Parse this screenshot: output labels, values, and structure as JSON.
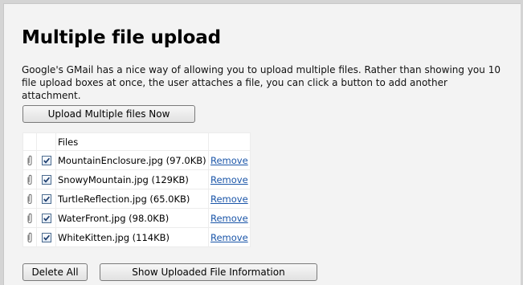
{
  "page": {
    "title": "Multiple file upload",
    "description": "Google's GMail has a nice way of allowing you to upload multiple files. Rather than showing you 10 file upload boxes at once, the user attaches a file, you can click a button to add another attachment."
  },
  "buttons": {
    "upload": "Upload Multiple files Now",
    "delete_all": "Delete All",
    "show_info": "Show Uploaded File Information"
  },
  "table": {
    "header": "Files",
    "remove_label": "Remove",
    "rows": [
      {
        "file": "MountainEnclosure.jpg (97.0KB)",
        "checked": true
      },
      {
        "file": "SnowyMountain.jpg (129KB)",
        "checked": true
      },
      {
        "file": "TurtleReflection.jpg (65.0KB)",
        "checked": true
      },
      {
        "file": "WaterFront.jpg (98.0KB)",
        "checked": true
      },
      {
        "file": "WhiteKitten.jpg (114KB)",
        "checked": true
      }
    ]
  },
  "colors": {
    "link": "#1a55a8",
    "background": "#f3f3f3",
    "border": "#d4d4d4"
  },
  "icons": {
    "attachment": "paperclip-icon",
    "checkbox": "checkbox-checked-icon"
  }
}
